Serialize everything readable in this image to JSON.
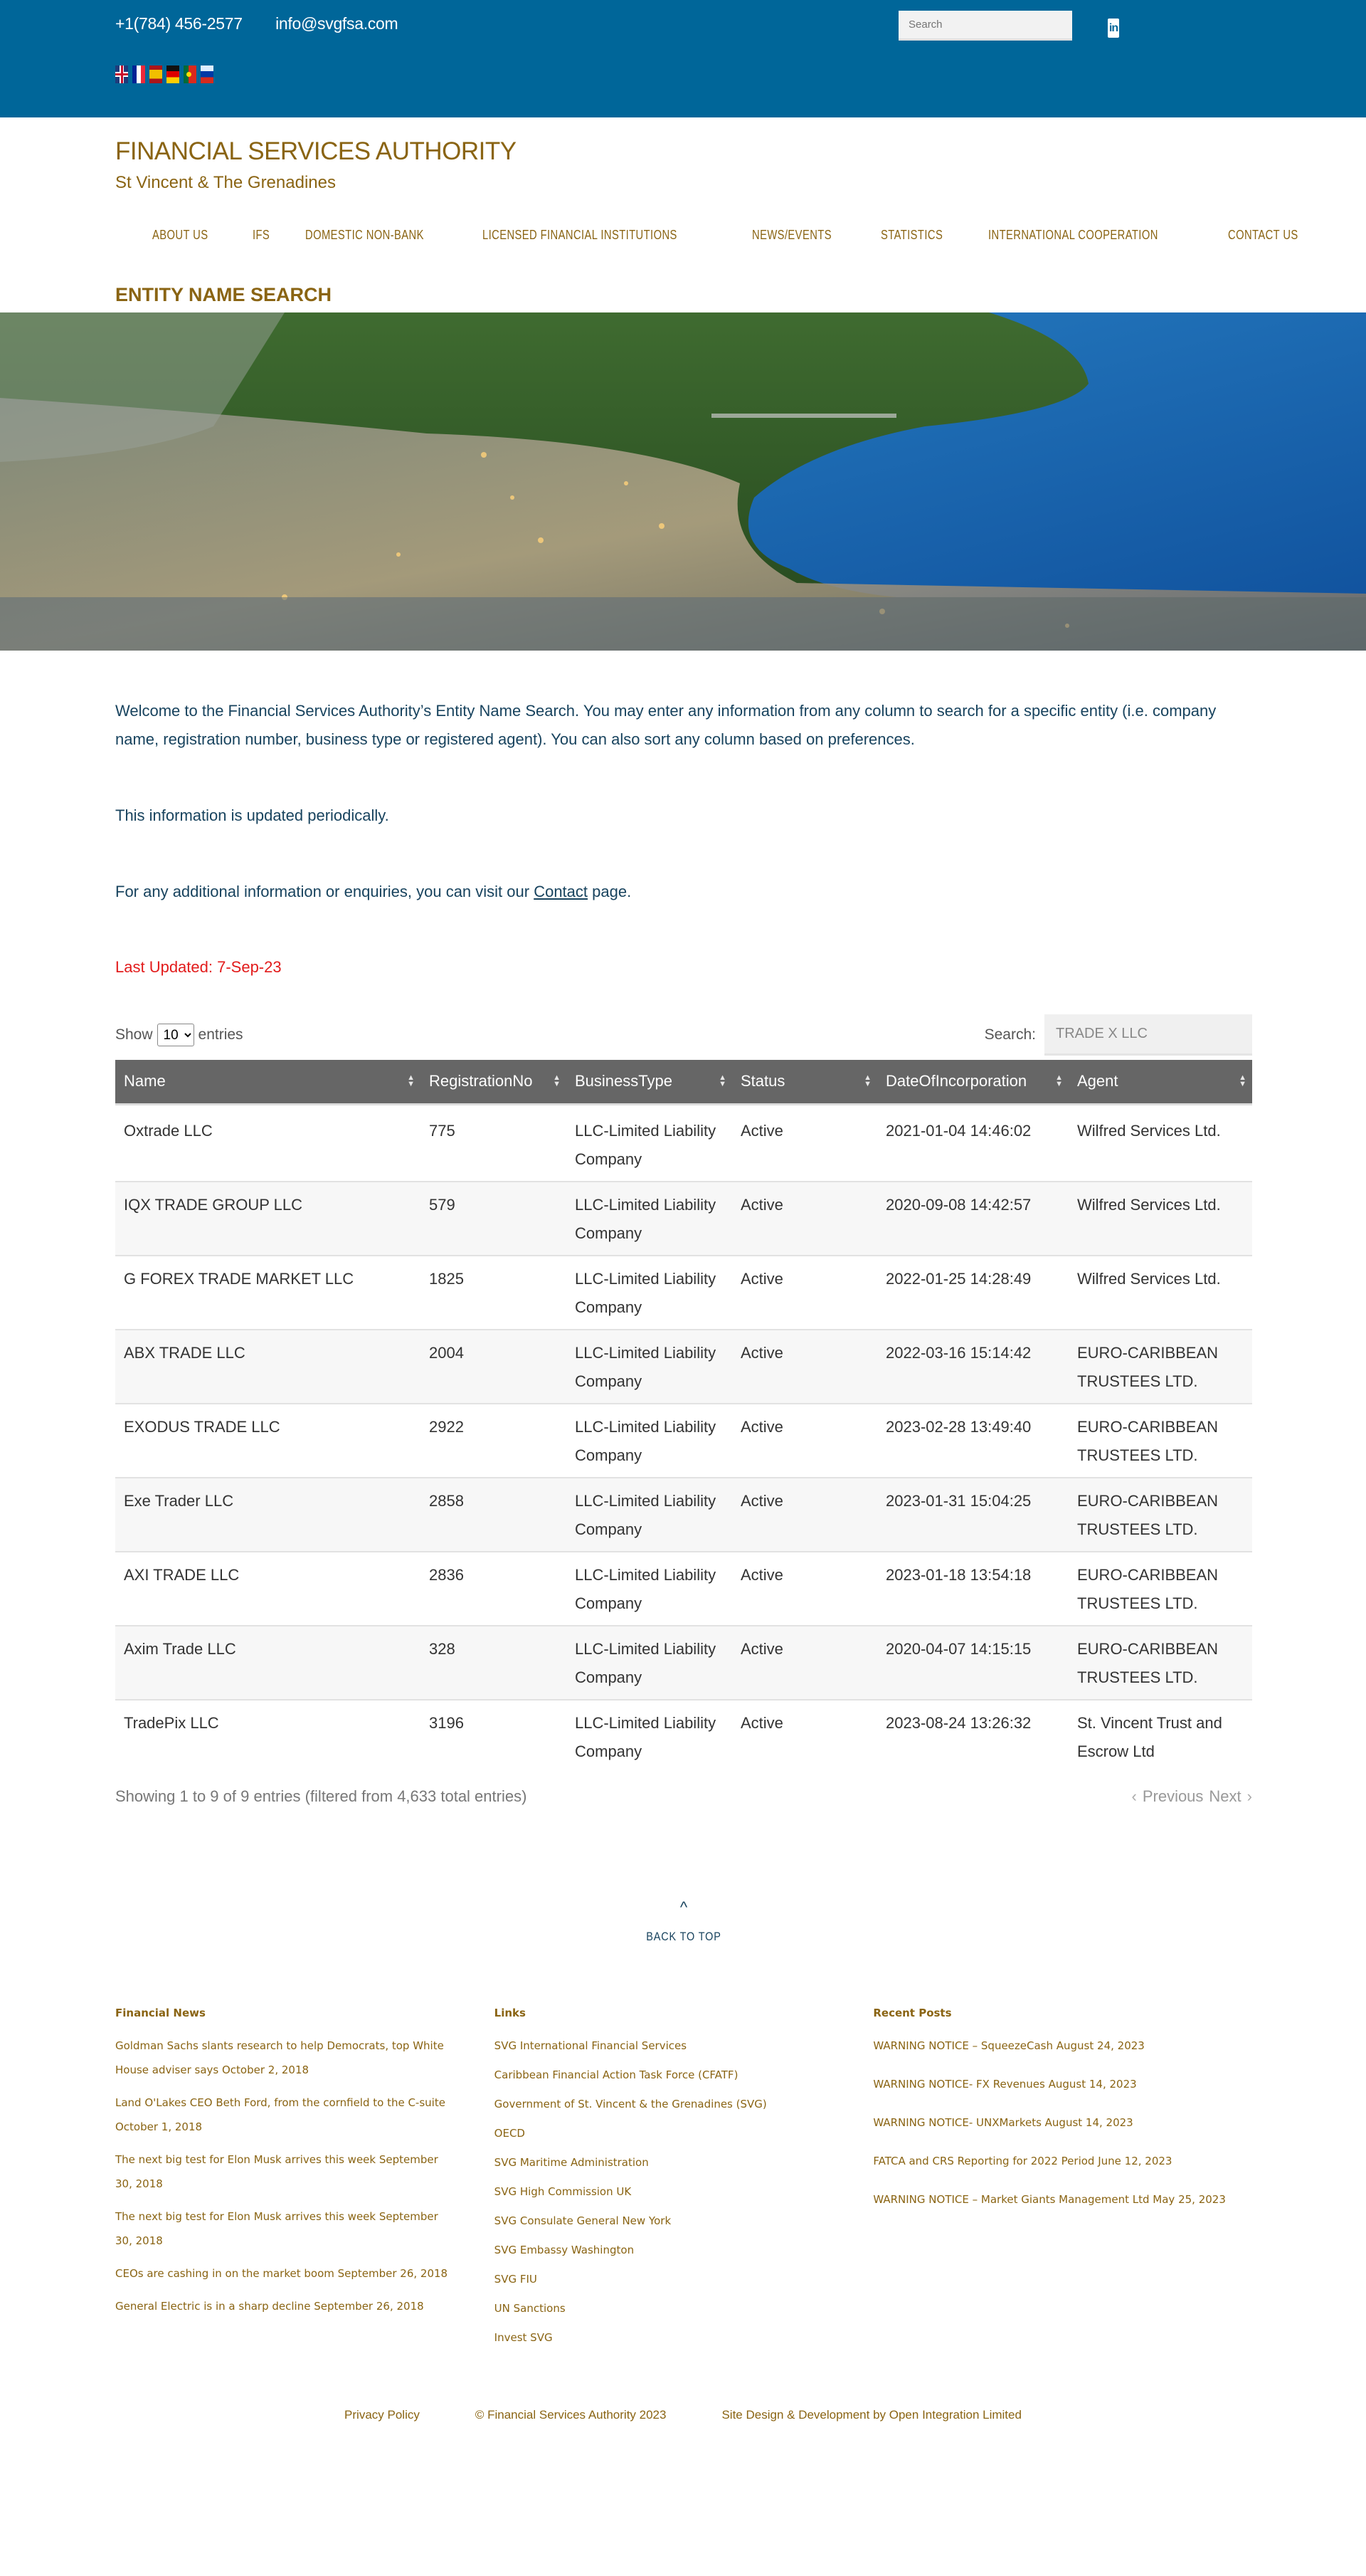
{
  "topbar": {
    "phone": "+1(784) 456-2577",
    "email": "info@svgfsa.com",
    "search_placeholder": "Search",
    "languages": [
      "English",
      "French",
      "Spanish",
      "German",
      "Portuguese",
      "Russian"
    ],
    "social": "linkedin-icon",
    "linkedin_text": "in"
  },
  "header": {
    "title": "FINANCIAL SERVICES AUTHORITY",
    "subtitle": "St Vincent & The Grenadines",
    "nav": [
      "ABOUT US",
      "IFS",
      "DOMESTIC NON-BANK",
      "LICENSED FINANCIAL INSTITUTIONS",
      "NEWS/EVENTS",
      "STATISTICS",
      "INTERNATIONAL COOPERATION",
      "CONTACT US"
    ],
    "page_heading": "ENTITY NAME SEARCH"
  },
  "colors": {
    "topbar": "#006699",
    "brand_gold": "#8a6413",
    "body_text": "#18435e",
    "alert": "#e21b1b",
    "table_header": "#666666"
  },
  "intro": {
    "p1": "Welcome to the Financial Services Authority’s Entity Name Search. You may enter any information from any column to search for a specific entity (i.e. company name, registration number, business type or registered agent). You can also sort any column based on preferences.",
    "p2": "This information is updated periodically.",
    "p3_before": "For any additional information or enquiries, you can visit our ",
    "p3_link": "Contact",
    "p3_after": " page.",
    "updated": "Last Updated:  7-Sep-23"
  },
  "table": {
    "show_label": "Show",
    "entries_label": "entries",
    "page_size": "10",
    "search_label": "Search:",
    "search_value": "TRADE X LLC",
    "columns": [
      "Name",
      "RegistrationNo",
      "BusinessType",
      "Status",
      "DateOfIncorporation",
      "Agent"
    ],
    "rows": [
      [
        "Oxtrade LLC",
        "775",
        "LLC-Limited Liability Company",
        "Active",
        "2021-01-04 14:46:02",
        "Wilfred Services Ltd."
      ],
      [
        "IQX TRADE GROUP LLC",
        "579",
        "LLC-Limited Liability Company",
        "Active",
        "2020-09-08 14:42:57",
        "Wilfred Services Ltd."
      ],
      [
        "G FOREX TRADE MARKET LLC",
        "1825",
        "LLC-Limited Liability Company",
        "Active",
        "2022-01-25 14:28:49",
        "Wilfred Services Ltd."
      ],
      [
        "ABX TRADE LLC",
        "2004",
        "LLC-Limited Liability Company",
        "Active",
        "2022-03-16 15:14:42",
        "EURO-CARIBBEAN TRUSTEES LTD."
      ],
      [
        "EXODUS TRADE LLC",
        "2922",
        "LLC-Limited Liability Company",
        "Active",
        "2023-02-28 13:49:40",
        "EURO-CARIBBEAN TRUSTEES LTD."
      ],
      [
        "Exe Trader LLC",
        "2858",
        "LLC-Limited Liability Company",
        "Active",
        "2023-01-31 15:04:25",
        "EURO-CARIBBEAN TRUSTEES LTD."
      ],
      [
        "AXI TRADE LLC",
        "2836",
        "LLC-Limited Liability Company",
        "Active",
        "2023-01-18 13:54:18",
        "EURO-CARIBBEAN TRUSTEES LTD."
      ],
      [
        "Axim Trade LLC",
        "328",
        "LLC-Limited Liability Company",
        "Active",
        "2020-04-07 14:15:15",
        "EURO-CARIBBEAN TRUSTEES LTD."
      ],
      [
        "TradePix LLC",
        "3196",
        "LLC-Limited Liability Company",
        "Active",
        "2023-08-24 13:26:32",
        "St. Vincent Trust and Escrow Ltd"
      ]
    ],
    "info": "Showing 1 to 9 of 9 entries (filtered from 4,633 total entries)",
    "previous": "Previous",
    "next": "Next"
  },
  "back_to_top": {
    "caret": "^",
    "label": "BACK TO TOP"
  },
  "widgets": {
    "news": {
      "title": "Financial News",
      "items": [
        "Goldman Sachs slants research to help Democrats, top White House adviser says October 2, 2018",
        "Land O'Lakes CEO Beth Ford, from the cornfield to the C-suite October 1, 2018",
        "The next big test for Elon Musk arrives this week September 30, 2018",
        "The next big test for Elon Musk arrives this week September 30, 2018",
        "CEOs are cashing in on the market boom September 26, 2018",
        "General Electric is in a sharp decline September 26, 2018"
      ]
    },
    "links": {
      "title": "Links",
      "items": [
        "SVG International Financial Services",
        "Caribbean Financial Action Task Force (CFATF)",
        "Government of St. Vincent & the Grenadines (SVG)",
        "OECD",
        "SVG Maritime Administration",
        "SVG High Commission UK",
        "SVG Consulate General New York",
        "SVG Embassy Washington",
        "SVG FIU",
        "UN Sanctions",
        "Invest SVG"
      ]
    },
    "posts": {
      "title": "Recent Posts",
      "items": [
        "WARNING NOTICE – SqueezeCash August 24, 2023",
        "WARNING NOTICE- FX Revenues August 14, 2023",
        "WARNING NOTICE- UNXMarkets August 14, 2023",
        "FATCA and CRS Reporting for 2022 Period June 12, 2023",
        "WARNING NOTICE – Market Giants Management Ltd May 25, 2023"
      ]
    }
  },
  "footer": {
    "privacy": "Privacy Policy",
    "copyright": "© Financial Services Authority 2023",
    "credit": "Site Design & Development by Open Integration Limited"
  }
}
